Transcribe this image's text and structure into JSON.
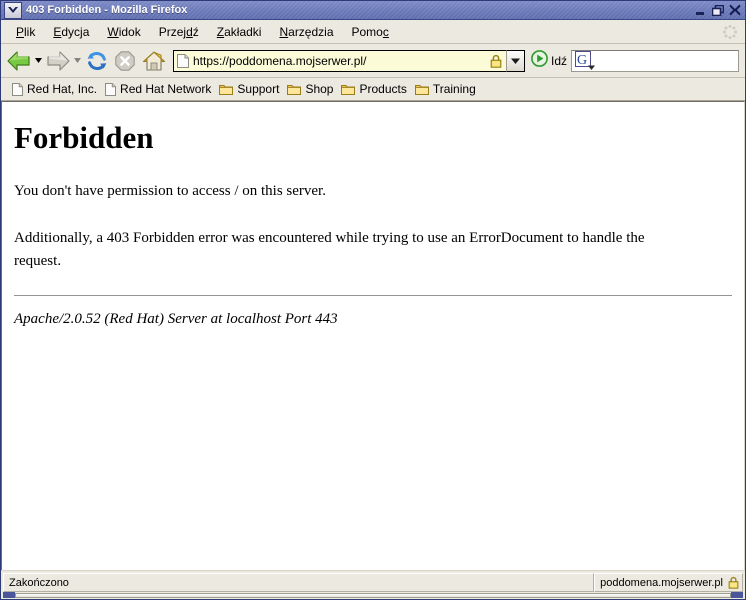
{
  "window": {
    "title": "403 Forbidden - Mozilla Firefox",
    "menu_icon": "chevron-down-icon",
    "controls": {
      "minimize": "minimize-icon",
      "restore": "restore-icon",
      "close": "close-icon"
    },
    "titlebar_color": "#6e7cbb",
    "chrome_color": "#ece9e0"
  },
  "menubar": {
    "items": [
      {
        "label": "Plik",
        "accel": "P"
      },
      {
        "label": "Edycja",
        "accel": "E"
      },
      {
        "label": "Widok",
        "accel": "W"
      },
      {
        "label": "Przejdź",
        "accel": "d"
      },
      {
        "label": "Zakładki",
        "accel": "Z"
      },
      {
        "label": "Narzędzia",
        "accel": "N"
      },
      {
        "label": "Pomoc",
        "accel": "c"
      }
    ],
    "throbber": "throbber-icon"
  },
  "toolbar": {
    "back": {
      "name": "back-button",
      "icon": "arrow-left-icon",
      "enabled": true
    },
    "forward": {
      "name": "forward-button",
      "icon": "arrow-right-icon",
      "enabled": false
    },
    "reload": {
      "name": "reload-button",
      "icon": "reload-icon",
      "enabled": true
    },
    "stop": {
      "name": "stop-button",
      "icon": "stop-icon",
      "enabled": false
    },
    "home": {
      "name": "home-button",
      "icon": "home-icon",
      "enabled": true
    },
    "urlbar": {
      "value": "https://poddomena.mojserwer.pl/",
      "placeholder": "",
      "favicon": "page-icon",
      "lock_icon": "padlock-icon",
      "dropdown_icon": "chevron-down-icon",
      "secure_background": "#fbfbd8"
    },
    "go": {
      "label": "Idź",
      "icon": "go-icon"
    },
    "search": {
      "value": "",
      "placeholder": "",
      "engine_icon": "google-g-icon",
      "engine_dropdown_icon": "chevron-down-icon"
    }
  },
  "bookmarks": {
    "items": [
      {
        "label": "Red Hat, Inc.",
        "icon": "page-icon"
      },
      {
        "label": "Red Hat Network",
        "icon": "page-icon"
      },
      {
        "label": "Support",
        "icon": "folder-icon"
      },
      {
        "label": "Shop",
        "icon": "folder-icon"
      },
      {
        "label": "Products",
        "icon": "folder-icon"
      },
      {
        "label": "Training",
        "icon": "folder-icon"
      }
    ]
  },
  "page": {
    "heading": "Forbidden",
    "paragraph1": "You don't have permission to access / on this server.",
    "paragraph2": "Additionally, a 403 Forbidden error was encountered while trying to use an ErrorDocument to handle the request.",
    "signature": "Apache/2.0.52 (Red Hat) Server at localhost Port 443"
  },
  "statusbar": {
    "status": "Zakończono",
    "security_domain": "poddomena.mojserwer.pl",
    "security_icon": "padlock-icon"
  }
}
